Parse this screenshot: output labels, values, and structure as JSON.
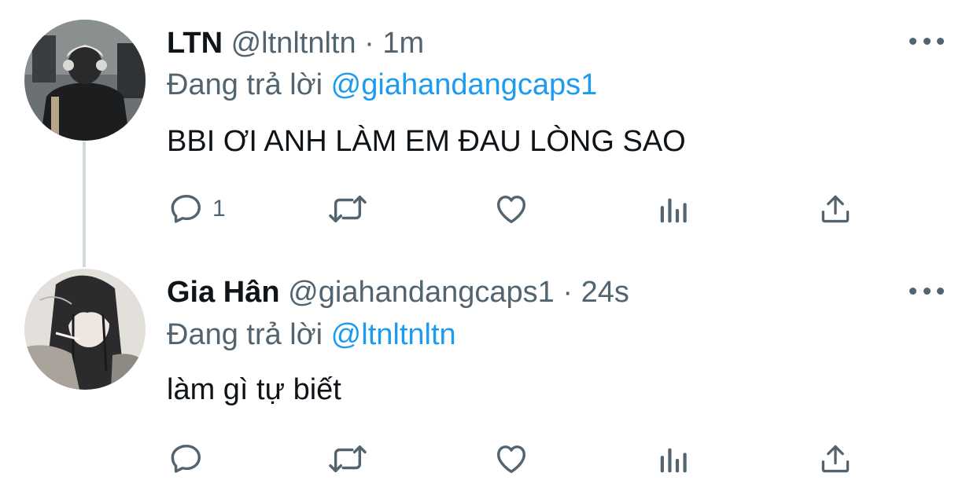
{
  "tweets": [
    {
      "display_name": "LTN",
      "handle": "@ltnltnltn",
      "separator": "·",
      "time": "1m",
      "reply_prefix": "Đang trả lời",
      "reply_to": "@giahandangcaps1",
      "text": "BBI ƠI ANH LÀM EM ĐAU LÒNG SAO",
      "reply_count": "1"
    },
    {
      "display_name": "Gia Hân",
      "handle": "@giahandangcaps1",
      "separator": "·",
      "time": "24s",
      "reply_prefix": "Đang trả lời",
      "reply_to": "@ltnltnltn",
      "text": "làm gì tự biết",
      "reply_count": ""
    }
  ],
  "colors": {
    "text": "#0f1419",
    "secondary": "#536471",
    "link": "#1d9bf0",
    "thread_line": "#cfd9de"
  },
  "icons": {
    "reply": "reply-icon",
    "retweet": "retweet-icon",
    "like": "heart-icon",
    "analytics": "analytics-icon",
    "share": "share-icon",
    "more": "more-icon"
  }
}
